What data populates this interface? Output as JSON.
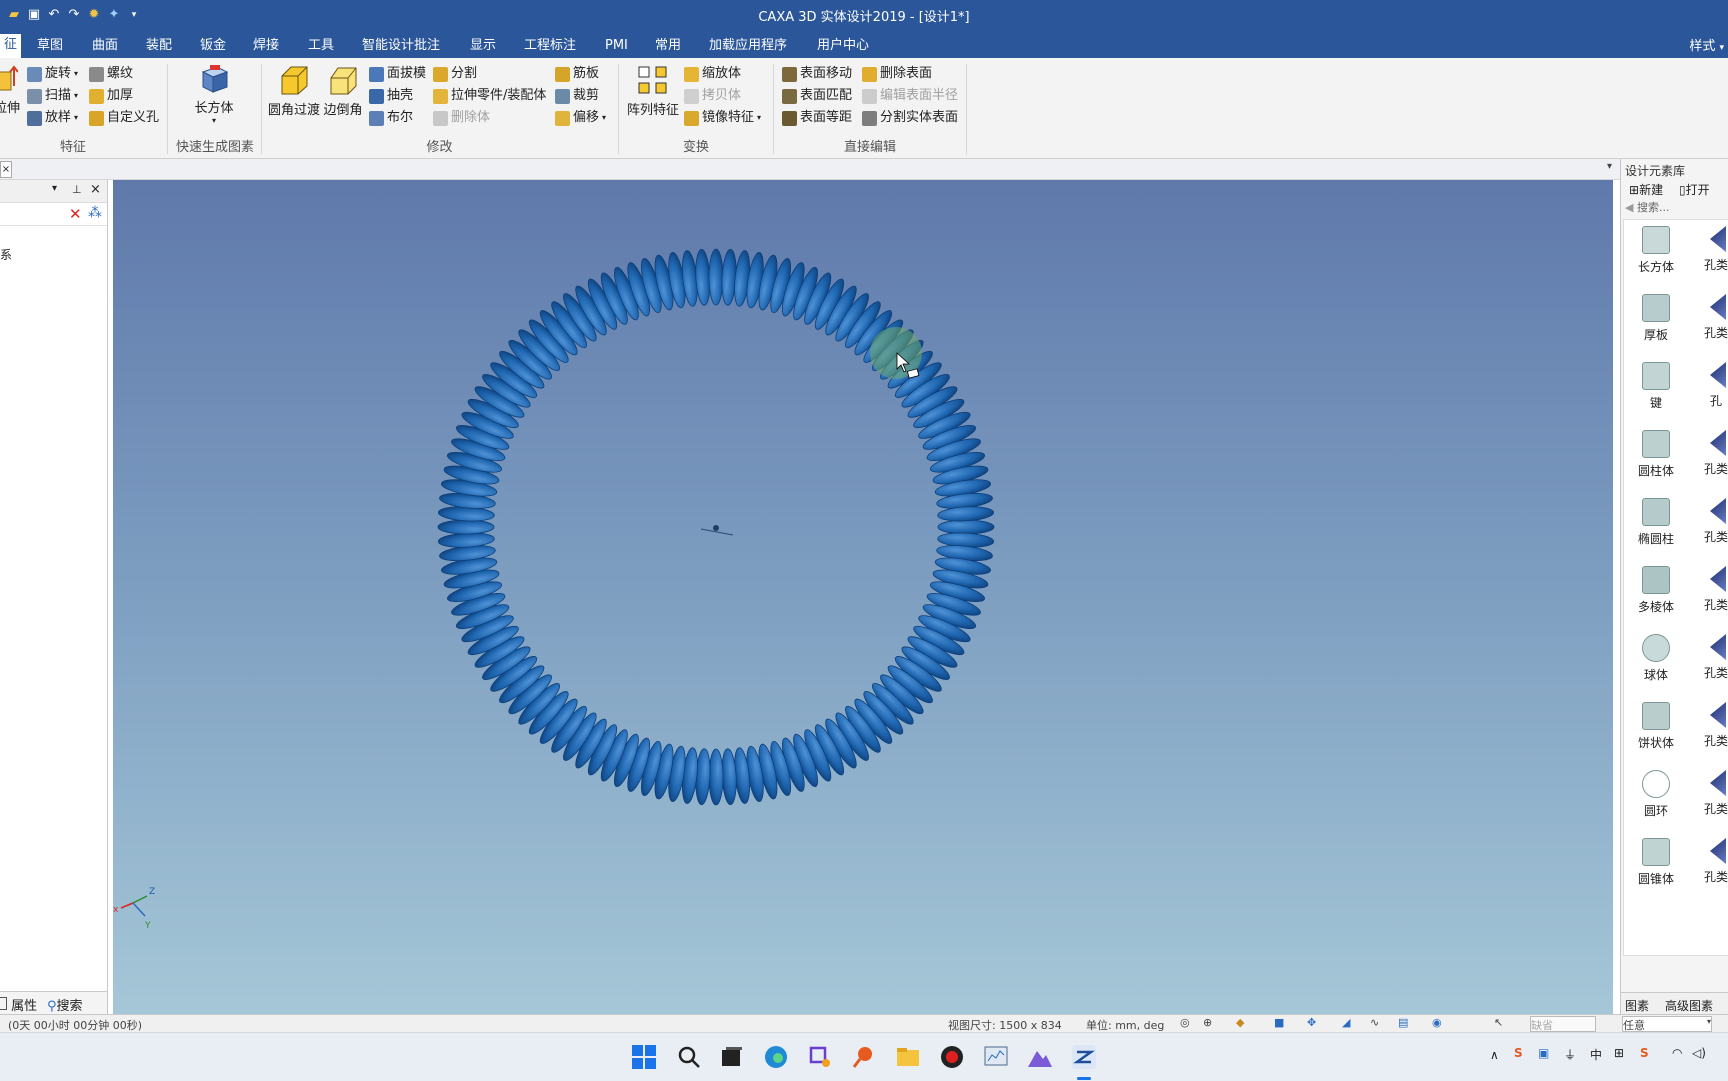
{
  "app": {
    "title": "CAXA 3D 实体设计2019 - [设计1*]"
  },
  "menu": {
    "active_tab": "征",
    "tabs": [
      "草图",
      "曲面",
      "装配",
      "钣金",
      "焊接",
      "工具",
      "智能设计批注",
      "显示",
      "工程标注",
      "PMI",
      "常用",
      "加载应用程序",
      "用户中心"
    ],
    "style_label": "样式"
  },
  "ribbon": {
    "feature": {
      "extrude": "拉伸",
      "rotate": "旋转",
      "sweep": "扫描",
      "loft": "放样",
      "thread": "螺纹",
      "thicken": "加厚",
      "custom_hole": "自定义孔",
      "label": "特征"
    },
    "quick": {
      "box": "长方体",
      "label": "快速生成图素"
    },
    "modify": {
      "fillet": "圆角过渡",
      "chamfer": "边倒角",
      "draft": "面拔模",
      "shell": "抽壳",
      "boolean": "布尔",
      "split": "分割",
      "extrude_part": "拉伸零件/装配体",
      "delete_body": "删除体",
      "rib": "筋板",
      "trim": "裁剪",
      "offset": "偏移",
      "label": "修改"
    },
    "transform": {
      "pattern": "阵列特征",
      "scale": "缩放体",
      "copy": "拷贝体",
      "mirror": "镜像特征",
      "label": "变换"
    },
    "direct_edit": {
      "move_face": "表面移动",
      "match_face": "表面匹配",
      "equal_face": "表面等距",
      "delete_face": "删除表面",
      "edit_radius": "编辑表面半径",
      "split_solid": "分割实体表面",
      "label": "直接编辑"
    }
  },
  "left_panel": {
    "tree_item": "系",
    "tabs": {
      "properties": "属性",
      "search": "搜索"
    }
  },
  "design_library": {
    "title": "设计元素库",
    "new_label": "新建",
    "open_label": "打开",
    "search_placeholder": "搜索...",
    "items": [
      "长方体",
      "厚板",
      "键",
      "圆柱体",
      "椭圆柱",
      "多棱体",
      "球体",
      "饼状体",
      "圆环",
      "圆锥体"
    ],
    "items_right": [
      "孔类",
      "孔类",
      "孔",
      "孔类",
      "孔类",
      "孔类",
      "孔类",
      "孔类",
      "孔类",
      "孔类"
    ],
    "bottom_tabs": {
      "elements": "图素",
      "advanced": "高级图素"
    }
  },
  "status": {
    "time": "(0天 00小时 00分钟 00秒)",
    "view_size": "视图尺寸: 1500 x 834",
    "units": "单位: mm, deg",
    "select_mode": "任意",
    "default_label": "缺省"
  },
  "model": {
    "coil_count": 120,
    "color": "#1f66b0"
  },
  "colors": {
    "brand": "#2b579a",
    "coil": "#1f66b0",
    "coil_dark": "#0d3f7a",
    "coil_light": "#4f92d6"
  }
}
